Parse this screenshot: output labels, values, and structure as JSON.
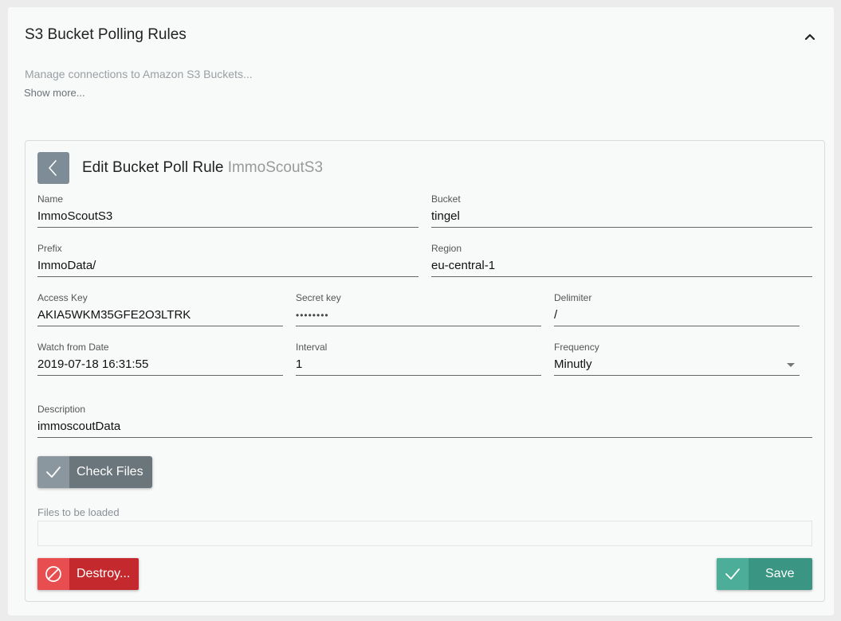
{
  "section": {
    "title": "S3 Bucket Polling Rules",
    "description": "Manage connections to Amazon S3 Buckets...",
    "show_more": "Show more..."
  },
  "card": {
    "title": "Edit Bucket Poll Rule",
    "subtitle": "ImmoScoutS3"
  },
  "fields": {
    "name": {
      "label": "Name",
      "value": "ImmoScoutS3"
    },
    "bucket": {
      "label": "Bucket",
      "value": "tingel"
    },
    "prefix": {
      "label": "Prefix",
      "value": "ImmoData/"
    },
    "region": {
      "label": "Region",
      "value": "eu-central-1"
    },
    "access_key": {
      "label": "Access Key",
      "value": "AKIA5WKM35GFE2O3LTRK"
    },
    "secret_key": {
      "label": "Secret key",
      "value": "••••••••"
    },
    "delimiter": {
      "label": "Delimiter",
      "value": "/"
    },
    "watch_from": {
      "label": "Watch from Date",
      "value": "2019-07-18 16:31:55"
    },
    "interval": {
      "label": "Interval",
      "value": "1"
    },
    "frequency": {
      "label": "Frequency",
      "value": "Minutly"
    },
    "description": {
      "label": "Description",
      "value": "immoscoutData"
    }
  },
  "buttons": {
    "check_files": "Check Files",
    "destroy": "Destroy...",
    "save": "Save"
  },
  "files": {
    "label": "Files to be loaded"
  },
  "icons": {
    "collapse": "chevron-up-icon",
    "back": "chevron-left-icon",
    "check": "check-icon",
    "destroy": "ban-icon",
    "save": "check-icon"
  },
  "colors": {
    "destroy": "#c42a2d",
    "save": "#3a9683",
    "check": "#6a757c",
    "back": "#7d8c96"
  }
}
